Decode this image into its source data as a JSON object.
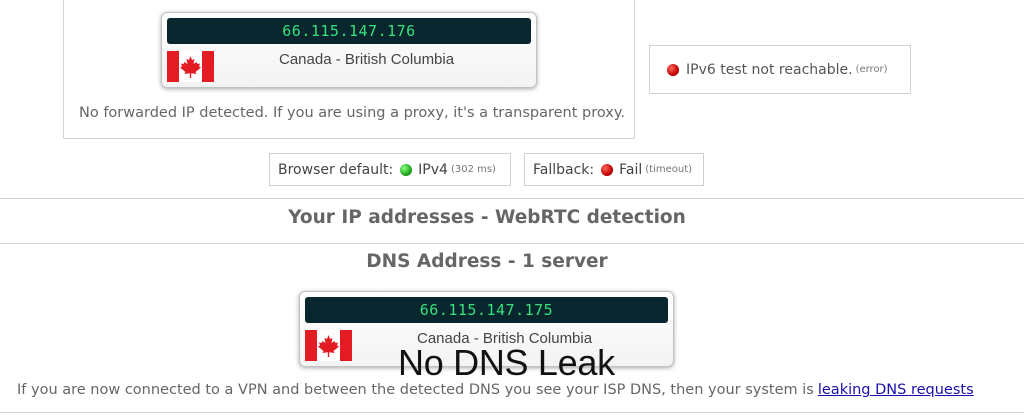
{
  "ipv4": {
    "address": "66.115.147.176",
    "location": "Canada - British Columbia",
    "flag_icon": "canada-flag-icon",
    "forwarded_note": "No forwarded IP detected. If you are using a proxy, it's a transparent proxy."
  },
  "ipv6": {
    "status_text": "IPv6 test not reachable.",
    "status_detail": "(error)",
    "status_color": "#cc0000"
  },
  "connection": {
    "browser_default_label": "Browser default:",
    "browser_default_value": "IPv4",
    "browser_default_detail": "(302 ms)",
    "browser_default_color": "#1ea81e",
    "fallback_label": "Fallback:",
    "fallback_value": "Fail",
    "fallback_detail": "(timeout)",
    "fallback_color": "#cc0000"
  },
  "webrtc": {
    "heading": "Your IP addresses - WebRTC detection"
  },
  "dns": {
    "heading": "DNS Address - 1 server",
    "address": "66.115.147.175",
    "location": "Canada - British Columbia",
    "flag_icon": "canada-flag-icon",
    "overlay_text": "No DNS Leak",
    "note": "If you are now connected to a VPN and between the detected DNS you see your ISP DNS, then your system is",
    "link_text": "leaking DNS requests"
  }
}
